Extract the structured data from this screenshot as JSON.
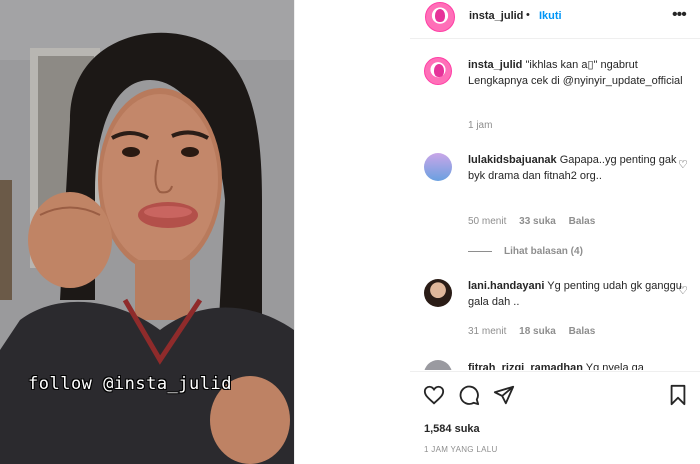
{
  "post": {
    "username": "insta_julid",
    "separator": "•",
    "follow_label": "Ikuti",
    "more_label": "•••",
    "media_caption": "follow @insta_julid"
  },
  "caption": {
    "username": "insta_julid",
    "text": "\"ikhlas kan a▯\" ngabrut Lengkapnya cek di @nyinyir_update_official",
    "time": "1 jam"
  },
  "comments": [
    {
      "username": "lulakidsbajuanak",
      "text": "Gapapa..yg penting gak byk drama dan fitnah2 org..",
      "time": "50 menit",
      "likes": "33 suka",
      "reply": "Balas"
    },
    {
      "username": "lani.handayani",
      "text": "Yg penting udah gk ganggu gala dah ..",
      "time": "31 menit",
      "likes": "18 suka",
      "reply": "Balas"
    },
    {
      "username": "fitrah_rizqi_ramadhan",
      "text": "Yg nyela ga",
      "time": "",
      "likes": "",
      "reply": ""
    }
  ],
  "view_replies": "Lihat balasan (4)",
  "likes_count": "1,584 suka",
  "posted_time": "1 JAM YANG LALU",
  "icons": {
    "heart": "heart-icon",
    "comment": "comment-icon",
    "share": "send-icon",
    "save": "bookmark-icon"
  },
  "colors": {
    "accent": "#0095f6",
    "text": "#262626",
    "muted": "#8e8e8e"
  }
}
